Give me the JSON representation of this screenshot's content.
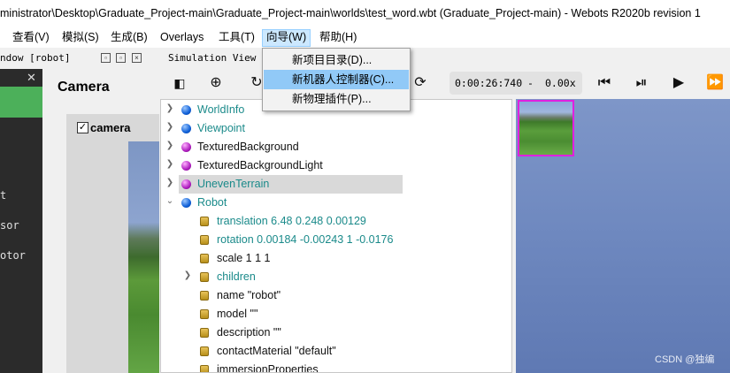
{
  "window": {
    "title": "ministrator\\Desktop\\Graduate_Project-main\\Graduate_Project-main\\worlds\\test_word.wbt (Graduate_Project-main) - Webots R2020b revision 1"
  },
  "menubar": {
    "items": [
      "查看(V)",
      "模拟(S)",
      "生成(B)",
      "Overlays",
      "工具(T)",
      "向导(W)",
      "帮助(H)"
    ]
  },
  "wizard_menu": {
    "items": [
      "新项目目录(D)...",
      "新机器人控制器(C)...",
      "新物理插件(P)..."
    ],
    "highlighted_index": 1
  },
  "robot_window": {
    "title": "ndow [robot]",
    "left_items": [
      "t",
      "sor",
      "otor"
    ],
    "panel_title": "Camera",
    "device_label": "camera",
    "device_checked": true
  },
  "simulation_view": {
    "title": "Simulation View",
    "time": "0:00:26:740",
    "separator": "-",
    "speed": "0.00x"
  },
  "scene_tree": {
    "nodes": [
      {
        "label": "WorldInfo",
        "icon": "blue-ball",
        "expand": "collapsed",
        "color": "teal"
      },
      {
        "label": "Viewpoint",
        "icon": "blue-ball",
        "expand": "collapsed",
        "color": "teal"
      },
      {
        "label": "TexturedBackground",
        "icon": "purple-ball",
        "expand": "collapsed",
        "color": "black"
      },
      {
        "label": "TexturedBackgroundLight",
        "icon": "purple-ball",
        "expand": "collapsed",
        "color": "black"
      },
      {
        "label": "UnevenTerrain",
        "icon": "purple-ball",
        "expand": "collapsed",
        "color": "teal",
        "selected": true
      },
      {
        "label": "Robot",
        "icon": "blue-ball",
        "expand": "expanded",
        "color": "teal"
      }
    ],
    "robot_fields": [
      {
        "label": "translation 6.48 0.248 0.00129",
        "color": "teal"
      },
      {
        "label": "rotation 0.00184 -0.00243 1 -0.0176",
        "color": "teal"
      },
      {
        "label": "scale 1 1 1",
        "color": "black"
      },
      {
        "label": "children",
        "color": "teal",
        "expand": "collapsed"
      },
      {
        "label": "name \"robot\"",
        "color": "black"
      },
      {
        "label": "model \"\"",
        "color": "black"
      },
      {
        "label": "description \"\"",
        "color": "black"
      },
      {
        "label": "contactMaterial \"default\"",
        "color": "black"
      },
      {
        "label": "immersionProperties",
        "color": "black"
      }
    ]
  },
  "watermark": "CSDN @独编",
  "colors": {
    "accent_green": "#4cb05a",
    "menu_highlight": "#91c9f7",
    "teal_text": "#1a8a8a",
    "camera_border": "#e020e0"
  }
}
